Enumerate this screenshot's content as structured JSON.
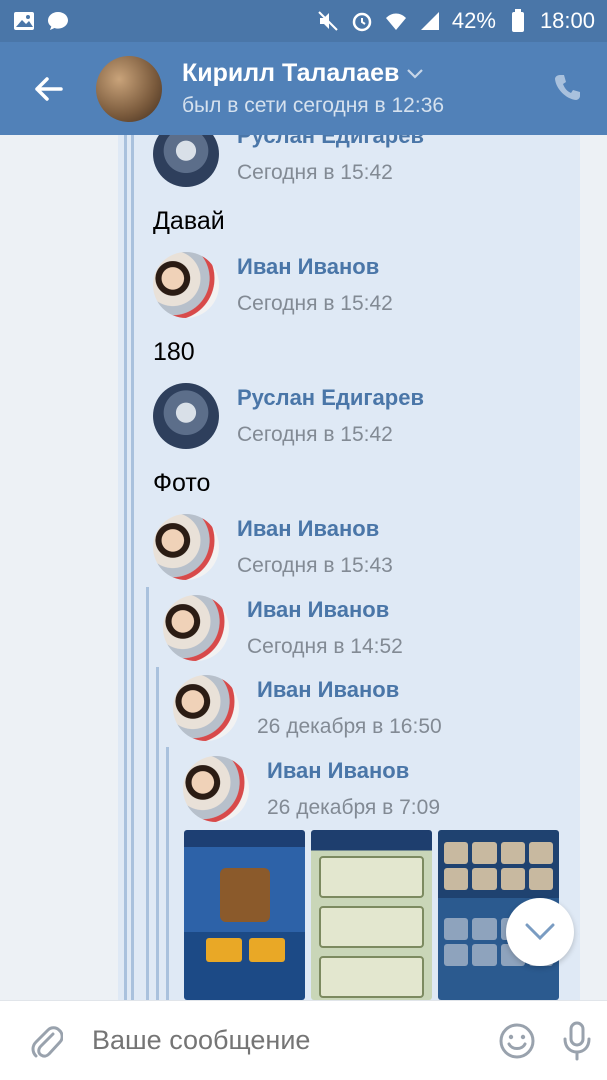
{
  "statusbar": {
    "battery": "42%",
    "time": "18:00",
    "icons": [
      "image-icon",
      "chat-icon",
      "mute-icon",
      "alarm-icon",
      "wifi-icon",
      "signal-icon",
      "battery-icon"
    ]
  },
  "header": {
    "name": "Кирилл Талалаев",
    "status": "был в сети сегодня в 12:36",
    "icons": [
      "back-arrow-icon",
      "chevron-down-icon",
      "phone-icon"
    ]
  },
  "messages": [
    {
      "author": "Руслан Едигарев",
      "time": "Сегодня в 15:42",
      "avatar": "ruslan"
    },
    {
      "text": "Давай"
    },
    {
      "author": "Иван Иванов",
      "time": "Сегодня в 15:42",
      "avatar": "ivan"
    },
    {
      "text": "180"
    },
    {
      "author": "Руслан Едигарев",
      "time": "Сегодня в 15:42",
      "avatar": "ruslan"
    },
    {
      "text": "Фото"
    },
    {
      "author": "Иван Иванов",
      "time": "Сегодня в 15:43",
      "avatar": "ivan"
    },
    {
      "author": "Иван Иванов",
      "time": "Сегодня в 14:52",
      "avatar": "ivan"
    },
    {
      "author": "Иван Иванов",
      "time": "26 декабря в 16:50",
      "avatar": "ivan"
    },
    {
      "author": "Иван Иванов",
      "time": "26 декабря в 7:09",
      "avatar": "ivan"
    }
  ],
  "composer": {
    "placeholder": "Ваше сообщение",
    "icons": [
      "attach-icon",
      "emoji-icon",
      "mic-icon"
    ]
  },
  "colors": {
    "header": "#5181b8",
    "accent": "#4a76a8",
    "bubble": "#dfe9f5"
  }
}
